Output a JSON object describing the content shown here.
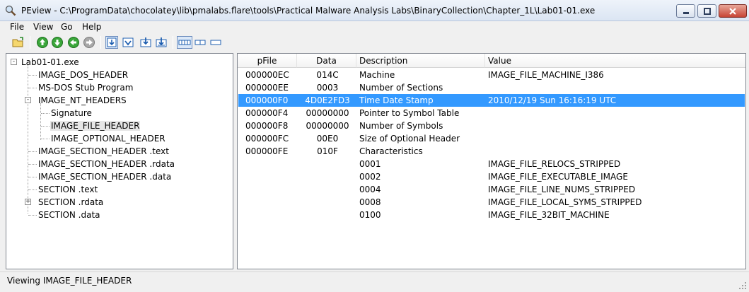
{
  "window": {
    "title": "PEview - C:\\ProgramData\\chocolatey\\lib\\pmalabs.flare\\tools\\Practical Malware Analysis Labs\\BinaryCollection\\Chapter_1L\\Lab01-01.exe",
    "icon": "magnifier-icon"
  },
  "menu": [
    "File",
    "View",
    "Go",
    "Help"
  ],
  "toolbar": {
    "buttons": [
      "open-folder-icon",
      "arrow-up-icon",
      "arrow-down-icon",
      "arrow-back-icon",
      "arrow-forward-icon",
      "view-mode-1-icon",
      "view-mode-2-icon",
      "view-mode-3-icon",
      "view-mode-4-icon",
      "view-bytes-icon",
      "view-word-icon",
      "view-dword-icon"
    ]
  },
  "tree": [
    {
      "label": "Lab01-01.exe",
      "expander": "-"
    },
    {
      "label": "IMAGE_DOS_HEADER"
    },
    {
      "label": "MS-DOS Stub Program"
    },
    {
      "label": "IMAGE_NT_HEADERS",
      "expander": "-"
    },
    {
      "label": "Signature"
    },
    {
      "label": "IMAGE_FILE_HEADER",
      "selected": true
    },
    {
      "label": "IMAGE_OPTIONAL_HEADER"
    },
    {
      "label": "IMAGE_SECTION_HEADER .text"
    },
    {
      "label": "IMAGE_SECTION_HEADER .rdata"
    },
    {
      "label": "IMAGE_SECTION_HEADER .data"
    },
    {
      "label": "SECTION .text"
    },
    {
      "label": "SECTION .rdata",
      "expander": "+"
    },
    {
      "label": "SECTION .data"
    }
  ],
  "columns": [
    "pFile",
    "Data",
    "Description",
    "Value"
  ],
  "rows": [
    {
      "pfile": "000000EC",
      "data": "014C",
      "description": "Machine",
      "value": "IMAGE_FILE_MACHINE_I386"
    },
    {
      "pfile": "000000EE",
      "data": "0003",
      "description": "Number of Sections",
      "value": ""
    },
    {
      "pfile": "000000F0",
      "data": "4D0E2FD3",
      "description": "Time Date Stamp",
      "value": "2010/12/19 Sun 16:16:19 UTC",
      "selected": true
    },
    {
      "pfile": "000000F4",
      "data": "00000000",
      "description": "Pointer to Symbol Table",
      "value": ""
    },
    {
      "pfile": "000000F8",
      "data": "00000000",
      "description": "Number of Symbols",
      "value": ""
    },
    {
      "pfile": "000000FC",
      "data": "00E0",
      "description": "Size of Optional Header",
      "value": ""
    },
    {
      "pfile": "000000FE",
      "data": "010F",
      "description": "Characteristics",
      "value": ""
    },
    {
      "pfile": "",
      "data": "",
      "description": "0001",
      "value": "IMAGE_FILE_RELOCS_STRIPPED"
    },
    {
      "pfile": "",
      "data": "",
      "description": "0002",
      "value": "IMAGE_FILE_EXECUTABLE_IMAGE"
    },
    {
      "pfile": "",
      "data": "",
      "description": "0004",
      "value": "IMAGE_FILE_LINE_NUMS_STRIPPED"
    },
    {
      "pfile": "",
      "data": "",
      "description": "0008",
      "value": "IMAGE_FILE_LOCAL_SYMS_STRIPPED"
    },
    {
      "pfile": "",
      "data": "",
      "description": "0100",
      "value": "IMAGE_FILE_32BIT_MACHINE"
    }
  ],
  "status": "Viewing IMAGE_FILE_HEADER",
  "colors": {
    "selection": "#3399ff",
    "tree_selection": "#e6e6e6"
  }
}
